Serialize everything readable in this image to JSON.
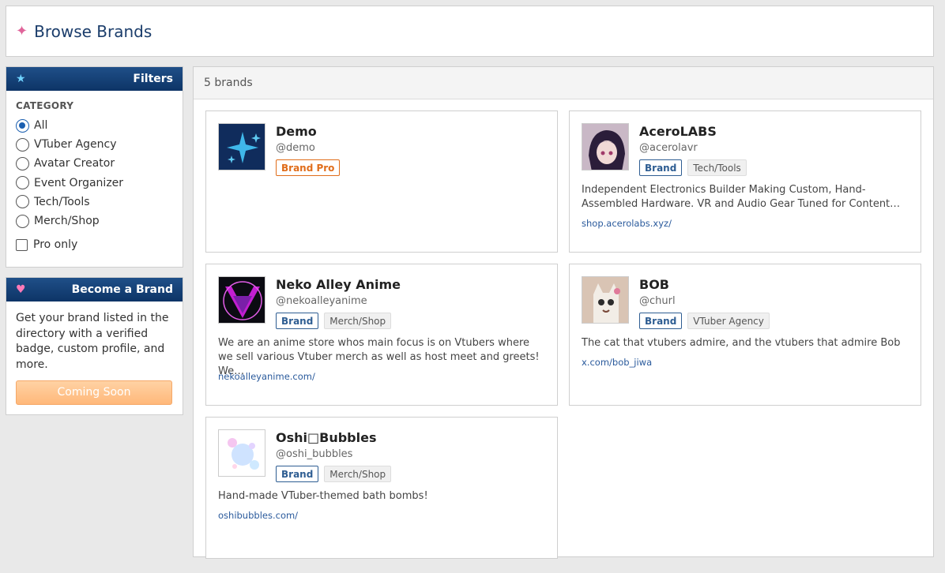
{
  "header": {
    "title": "Browse Brands",
    "icon": "sparkle-icon"
  },
  "filters": {
    "title": "Filters",
    "category_label": "CATEGORY",
    "options": [
      "All",
      "VTuber Agency",
      "Avatar Creator",
      "Event Organizer",
      "Tech/Tools",
      "Merch/Shop"
    ],
    "selected": "All",
    "pro_only_label": "Pro only"
  },
  "become_brand": {
    "title": "Become a Brand",
    "text": "Get your brand listed in the directory with a verified badge, custom profile, and more.",
    "button_label": "Coming Soon"
  },
  "results": {
    "count_text": "5 brands",
    "brands": [
      {
        "name": "Demo",
        "handle": "@demo",
        "badge": "Brand Pro",
        "tag": "",
        "description": "",
        "link": ""
      },
      {
        "name": "AceroLABS",
        "handle": "@acerolavr",
        "badge": "Brand",
        "tag": "Tech/Tools",
        "description": "Independent Electronics Builder Making Custom, Hand-Assembled Hardware. VR and Audio Gear Tuned for Content…",
        "link": "shop.acerolabs.xyz/"
      },
      {
        "name": "Neko Alley Anime",
        "handle": "@nekoalleyanime",
        "badge": "Brand",
        "tag": "Merch/Shop",
        "description": "We are an anime store whos main focus is on Vtubers where we sell various Vtuber merch as well as host meet and greets! We…",
        "link": "nekoalleyanime.com/"
      },
      {
        "name": "BOB",
        "handle": "@churl",
        "badge": "Brand",
        "tag": "VTuber Agency",
        "description": "The cat that vtubers admire, and the vtubers that admire Bob",
        "link": "x.com/bob_jiwa"
      },
      {
        "name": "Oshi□Bubbles",
        "handle": "@oshi_bubbles",
        "badge": "Brand",
        "tag": "Merch/Shop",
        "description": "Hand-made VTuber-themed bath bombs!",
        "link": "oshibubbles.com/"
      }
    ]
  },
  "colors": {
    "header_blue": "#0d3466",
    "title_blue": "#1b3d6b",
    "pro_orange": "#e06d1a",
    "brand_blue": "#2e5d92",
    "button_orange": "#ffb87a"
  }
}
